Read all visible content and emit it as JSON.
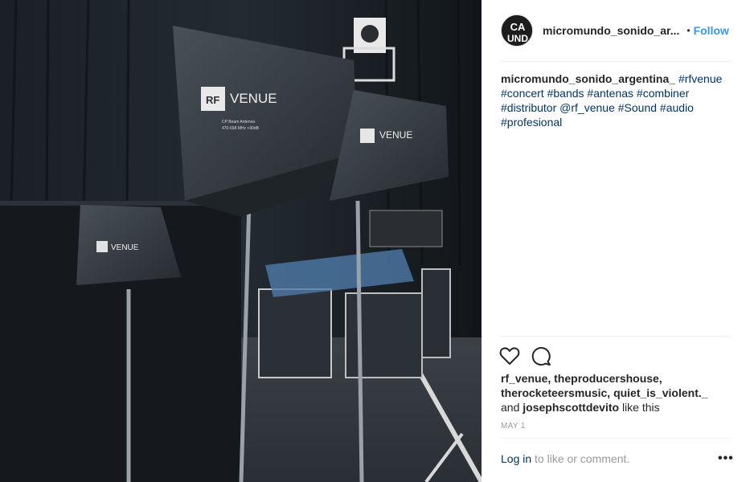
{
  "post": {
    "author": {
      "username": "micromundo_sonido_ar...",
      "avatar_text": "CA UND",
      "follow_label": "Follow",
      "separator": "•"
    },
    "caption": {
      "author": "micromundo_sonido_argentina_",
      "tags": [
        "#rfvenue",
        "#concert",
        "#bands",
        "#antenas",
        "#combiner",
        "#distributor",
        "@rf_venue",
        "#Sound",
        "#audio",
        "#profesional"
      ]
    },
    "photo": {
      "brand_text": "RF VENUE",
      "rf_badge": "RF",
      "venue_word": "VENUE",
      "product_line": "CP Beam Antenna",
      "freq_line": "470-698 MHz +90dB"
    },
    "actions": {
      "like_icon": "heart-icon",
      "comment_icon": "comment-icon"
    },
    "likes": {
      "users_line1": "rf_venue, theproducershouse,",
      "users_line2": "therocketeersmusic, quiet_is_violent._",
      "and_word": "and",
      "last_user": "josephscottdevito",
      "suffix": "like this"
    },
    "date": "MAY 1",
    "footer": {
      "login_label": "Log in",
      "rest_text": " to like or comment.",
      "more_label": "•••"
    }
  }
}
